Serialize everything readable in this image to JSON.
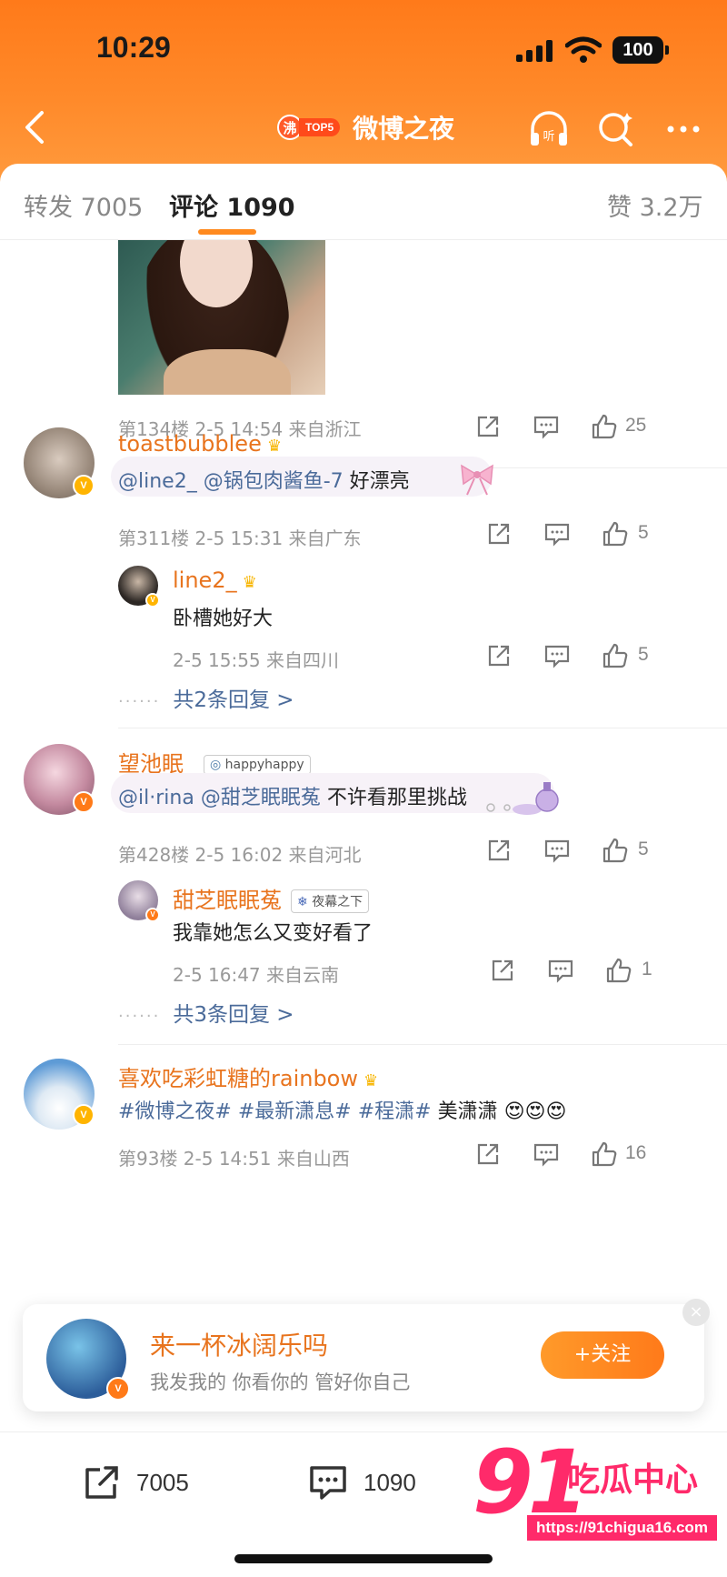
{
  "status_bar": {
    "time": "10:29",
    "battery": "100"
  },
  "nav": {
    "hot_badge": "沸",
    "hot_rank": "TOP5",
    "title": "微博之夜"
  },
  "tabs": {
    "repost_label": "转发",
    "repost_count": "7005",
    "comment_label": "评论",
    "comment_count": "1090",
    "like_label": "赞",
    "like_count": "3.2万"
  },
  "comments": [
    {
      "floor_meta": "第134楼  2-5 14:54  来自浙江",
      "likes": "25"
    },
    {
      "username": "toastbubblee",
      "mention1": "@line2_",
      "mention2": "@锅包肉酱鱼-7",
      "text": "好漂亮",
      "floor_meta": "第311楼  2-5 15:31  来自广东",
      "likes": "5",
      "reply": {
        "username": "line2_",
        "text": "卧槽她好大",
        "meta": "2-5 15:55  来自四川",
        "likes": "5"
      },
      "more_replies": "共2条回复 >"
    },
    {
      "username": "望池眠_",
      "tag": "happyhappy",
      "mention1": "@il·rina",
      "mention2": "@甜芝眠眠菟",
      "text": "不许看那里挑战",
      "floor_meta": "第428楼  2-5 16:02  来自河北",
      "likes": "5",
      "reply": {
        "username": "甜芝眠眠菟",
        "tag": "夜幕之下",
        "text": "我靠她怎么又变好看了",
        "meta": "2-5 16:47  来自云南",
        "likes": "1"
      },
      "more_replies": "共3条回复 >"
    },
    {
      "username": "喜欢吃彩虹糖的rainbow",
      "hashtags": "#微博之夜# #最新潇息# #程潇#",
      "text": "美潇潇",
      "emoji": "😍😍😍",
      "floor_meta": "第93楼  2-5 14:51  来自山西",
      "likes": "16"
    }
  ],
  "follow_card": {
    "name": "来一杯冰阔乐吗",
    "subtitle": "我发我的 你看你的 管好你自己",
    "button": "+关注",
    "close": "×"
  },
  "bottom_bar": {
    "repost_count": "7005",
    "comment_count": "1090"
  },
  "watermark": {
    "big": "91",
    "text": "吃瓜中心",
    "url": "https://91chigua16.com"
  },
  "colors": {
    "brand_orange": "#ff8a1f",
    "username_orange": "#e8741e",
    "link_blue": "#4b6b9a",
    "watermark_pink": "#ff2a6a"
  }
}
